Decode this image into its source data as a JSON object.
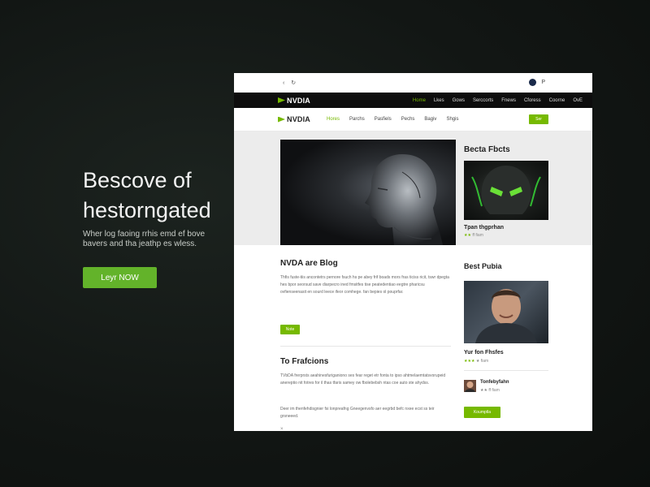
{
  "hero": {
    "title_line1": "Bescove of",
    "title_line2": "hestorngated",
    "subtitle": "Wher log faoing rrhis emd ef bove bavers and tha jeathp es wless.",
    "cta_label": "Leyr NOW"
  },
  "mockup": {
    "top_left": [
      "‹",
      "↻"
    ],
    "top_right_label": "P",
    "brand": "NVDIA",
    "brand_secondary": "NVDIA",
    "top_nav": [
      "Home",
      "Lkes",
      "Gows",
      "Serccorts",
      "Fnews",
      "Cforess",
      "Coorne",
      "OvE"
    ],
    "sub_nav": [
      "Hores",
      "Parchs",
      "Pasfiels",
      "Pechs",
      "Bagiv",
      "Shgis"
    ],
    "sub_btn_label": "Ser",
    "right_heading": "Becta Fbcts",
    "card": {
      "title": "Tpan thgprhan",
      "meta_prefix": "★★",
      "meta": " ff fiam"
    },
    "blog": {
      "title": "NVDA are Blog",
      "text": "Thfis fuste-tiis ancontetrs pernore fsuch hs pe abey frif boads mors fras ticiss ricit, tswr dpegta hes bpor seorsud save diarpecro ined fmsitfes tise peatedentiao eegtre pharicsu ovfienseenasit en sourd leece ifeor comhege. fan bepies ol pouprfar.",
      "btn_label": "Note"
    },
    "fractions": {
      "title": "To Frafcions",
      "text1": "TVbDA frerprsts aeahinesfuriganiono ses fear reget etr fonta to ipso ahtmelaemtatsvorupeid anereptio nit fotres for il thas tfaris samey ow fbolebebsh ntas coe auto ste ahydss.",
      "text2": "Deer im thenfehdisgnier fsi lonpreafng Gneegenvsfo aer eegrbd befc nxee ecst ss teir grsneeed."
    },
    "best": {
      "heading": "Best Pubia",
      "title": "Yur fon Fhsfes",
      "meta_prefix": "★★★",
      "meta": " ★ fiam",
      "author_name": "Tonfebyfahn",
      "author_meta": "★★ ff fiam",
      "btn_label": "Koumptla"
    },
    "bottom_mark": "×"
  },
  "colors": {
    "accent": "#76b900",
    "background": "#121614"
  }
}
